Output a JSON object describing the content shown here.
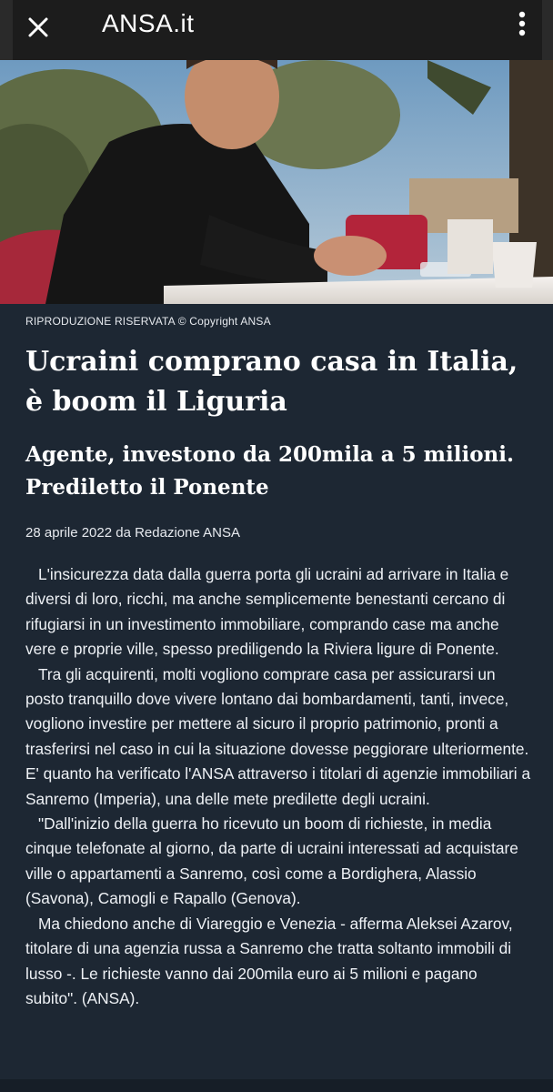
{
  "browser": {
    "site_title": "ANSA.it",
    "close_icon": "close-icon",
    "menu_icon": "kebab-menu-icon"
  },
  "hero": {
    "photo_credit": "RIPRODUZIONE RISERVATA © Copyright ANSA"
  },
  "article": {
    "headline": "Ucraini comprano casa in Italia, è boom il Liguria",
    "subheadline": "Agente, investono da 200mila a 5 milioni. Prediletto il Ponente",
    "byline": "28 aprile 2022 da Redazione ANSA",
    "paragraphs": [
      "L'insicurezza data dalla guerra porta gli ucraini ad arrivare in Italia e diversi di loro, ricchi, ma anche semplicemente benestanti cercano di rifugiarsi in un investimento immobiliare, comprando case ma anche vere e proprie ville, spesso prediligendo la Riviera ligure di Ponente.",
      "Tra gli acquirenti, molti vogliono comprare casa per assicurarsi un posto tranquillo dove vivere lontano dai bombardamenti, tanti, invece, vogliono investire per mettere al sicuro il proprio patrimonio, pronti a trasferirsi nel caso in cui la situazione dovesse peggiorare ulteriormente. E' quanto ha verificato l'ANSA attraverso i titolari di agenzie immobiliari a Sanremo (Imperia), una delle mete predilette degli ucraini.",
      "\"Dall'inizio della guerra ho ricevuto un boom di richieste, in media cinque telefonate al giorno, da parte di ucraini interessati ad acquistare ville o appartamenti a Sanremo, così come a Bordighera, Alassio (Savona), Camogli e Rapallo (Genova).",
      "Ma chiedono anche di Viareggio e Venezia - afferma Aleksei Azarov, titolare di una agenzia russa a Sanremo che tratta soltanto immobili di lusso -. Le richieste vanno dai 200mila euro ai 5 milioni e pagano subito\". (ANSA)."
    ]
  }
}
